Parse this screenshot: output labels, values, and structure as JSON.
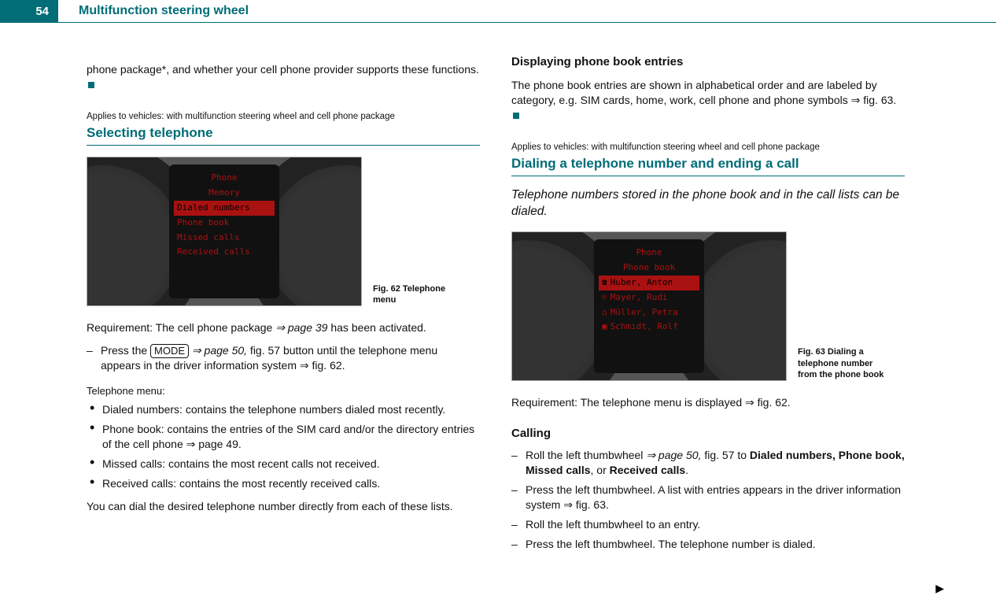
{
  "page_number": "54",
  "section": "Multifunction steering wheel",
  "left": {
    "intro_line": "phone package*, and whether your cell phone provider supports these functions.",
    "applies": "Applies to vehicles: with multifunction steering wheel and cell phone package",
    "topic": "Selecting telephone",
    "fig62_caption": "Fig. 62   Telephone menu",
    "fig62_lines": [
      "Phone",
      "Memory",
      "Dialed numbers",
      "Phone book",
      "Missed calls",
      "Received calls"
    ],
    "requirement_a": "Requirement: The cell phone package ",
    "requirement_b_ref": "⇒ page 39",
    "requirement_c": " has been activated.",
    "press_a": "Press the ",
    "press_btn": "MODE",
    "press_b_ref": " ⇒ page 50,",
    "press_c": " fig. 57 button until the telephone menu appears in the driver information system ⇒ fig. 62.",
    "menu_label": "Telephone menu:",
    "bullets": [
      "Dialed numbers: contains the telephone numbers dialed most recently.",
      "Phone book: contains the entries of the SIM card and/or the directory entries of the cell phone ⇒ page 49.",
      "Missed calls: contains the most recent calls not received.",
      "Received calls: contains the most recently received calls."
    ],
    "closing": "You can dial the desired telephone number directly from each of these lists."
  },
  "right": {
    "disp_heading": "Displaying phone book entries",
    "disp_body": "The phone book entries are shown in alphabetical order and are labeled by category, e.g. SIM cards, home, work, cell phone and phone symbols ⇒ fig. 63.",
    "applies": "Applies to vehicles: with multifunction steering wheel and cell phone package",
    "topic": "Dialing a telephone number and ending a call",
    "intro": "Telephone numbers stored in the phone book and in the call lists can be dialed.",
    "fig63_caption": "Fig. 63   Dialing a telephone number from the phone book",
    "fig63_lines": [
      "Phone",
      "Phone book",
      "Huber, Anton",
      "Mayer, Rudi",
      "Müller, Petra",
      "Schmidt, Rolf"
    ],
    "requirement": "Requirement: The telephone menu is displayed ⇒ fig. 62.",
    "calling_heading": "Calling",
    "steps": [
      {
        "a": "Roll the left thumbwheel ",
        "ref": "⇒ page 50,",
        "b": " fig. 57 to ",
        "bold": "Dialed numbers, Phone book, Missed calls",
        "b2": ", or ",
        "bold2": "Received calls",
        "end": "."
      },
      {
        "plain": "Press the left thumbwheel. A list with entries appears in the driver information system ⇒ fig. 63."
      },
      {
        "plain": "Roll the left thumbwheel to an entry."
      },
      {
        "plain": "Press the left thumbwheel. The telephone number is dialed."
      }
    ]
  }
}
